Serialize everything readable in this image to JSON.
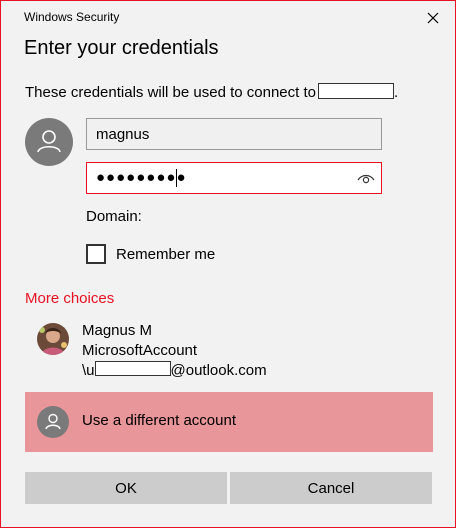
{
  "window": {
    "title": "Windows Security"
  },
  "dialog": {
    "heading": "Enter your credentials",
    "info_text": "These credentials will be used to connect to",
    "info_suffix": "."
  },
  "form": {
    "username_value": "magnus",
    "password_masked": "●●●●●●●●●",
    "domain_label": "Domain:",
    "remember_label": "Remember me",
    "remember_checked": false
  },
  "more_choices": {
    "label": "More choices",
    "account": {
      "name": "Magnus M",
      "type": "MicrosoftAccount",
      "email_prefix": "\\u",
      "email_suffix": "@outlook.com"
    },
    "different_account_label": "Use a different account"
  },
  "buttons": {
    "ok": "OK",
    "cancel": "Cancel"
  },
  "colors": {
    "accent": "#e81123",
    "selected_bg": "#e8969a",
    "button_bg": "#cccccc",
    "avatar_gray": "#7a7a7a"
  },
  "icons": {
    "close": "close-icon",
    "user": "user-icon",
    "reveal": "eye-icon"
  }
}
